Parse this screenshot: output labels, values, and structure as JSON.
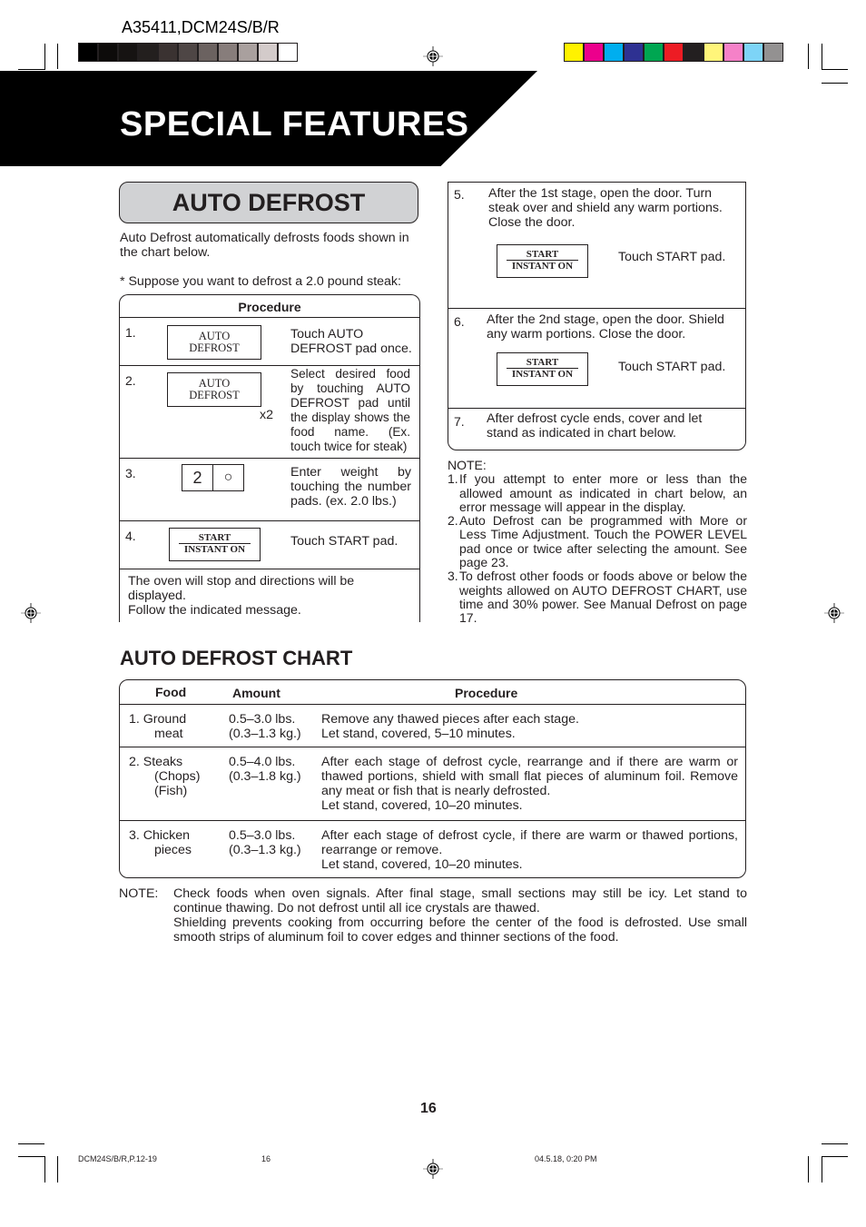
{
  "header": {
    "model": "A35411,DCM24S/B/R",
    "gray_swatches": [
      "#000000",
      "#0d0b0a",
      "#161312",
      "#231f1e",
      "#3a3231",
      "#4e4645",
      "#6b6260",
      "#877d7b",
      "#a9a09e",
      "#d3cbca",
      "#ffffff"
    ],
    "color_swatches": [
      "#fff200",
      "#ec008c",
      "#00aeef",
      "#2e3192",
      "#00a651",
      "#ed1c24",
      "#231f20",
      "#fff57a",
      "#f581c8",
      "#7dd4f7",
      "#939191"
    ]
  },
  "banner": {
    "title": "SPECIAL FEATURES"
  },
  "auto_defrost": {
    "title": "AUTO DEFROST",
    "intro": "Auto Defrost automatically defrosts foods shown in the chart below.",
    "suppose": "*  Suppose you  want to defrost a 2.0 pound steak:",
    "procedure_header": "Procedure",
    "steps": [
      {
        "num": "1.",
        "pad_top": "AUTO",
        "pad_bottom": "DEFROST",
        "text": "Touch AUTO DEFROST pad once."
      },
      {
        "num": "2.",
        "pad_top": "AUTO",
        "pad_bottom": "DEFROST",
        "multiplier": "x2",
        "text": "Select desired food by touching AUTO DEFROST pad until the display shows the food name. (Ex. touch twice for steak)"
      },
      {
        "num": "3.",
        "keys": [
          "2",
          "○"
        ],
        "text": "Enter weight by touching the number pads. (ex. 2.0 lbs.)"
      },
      {
        "num": "4.",
        "pad_top": "START",
        "pad_bottom": "INSTANT ON",
        "text": "Touch START pad."
      }
    ],
    "stop_message": "The oven will stop and directions will be displayed.",
    "follow_message": "Follow the indicated message.",
    "right_steps": [
      {
        "num": "5.",
        "text": "After the 1st stage, open the door. Turn steak over and shield any warm portions. Close the door.",
        "pad_top": "START",
        "pad_bottom": "INSTANT ON",
        "action": "Touch START pad."
      },
      {
        "num": "6.",
        "text": "After the 2nd stage, open the door. Shield any warm portions. Close the door.",
        "pad_top": "START",
        "pad_bottom": "INSTANT ON",
        "action": "Touch START pad."
      },
      {
        "num": "7.",
        "text": "After defrost cycle ends, cover and let stand as indicated in chart below."
      }
    ],
    "note": {
      "label": "NOTE:",
      "items": [
        {
          "n": "1.",
          "text": "If you attempt to enter more or less than the allowed amount as indicated in chart below, an  error message  will appear in the display."
        },
        {
          "n": "2.",
          "text": "Auto Defrost can be programmed with More or Less Time Adjustment. Touch the POWER LEVEL pad once or twice after selecting the amount. See page 23."
        },
        {
          "n": "3.",
          "text": "To defrost other foods or foods above or below the weights allowed on AUTO DEFROST CHART, use time and 30% power. See Manual Defrost on page 17."
        }
      ]
    }
  },
  "chart": {
    "title": "AUTO DEFROST CHART",
    "headers": {
      "food": "Food",
      "amount": "Amount",
      "procedure": "Procedure"
    },
    "rows": [
      {
        "food": [
          "1. Ground",
          "meat"
        ],
        "amount": [
          "0.5–3.0 lbs.",
          "(0.3–1.3 kg.)"
        ],
        "procedure": [
          "Remove any thawed pieces after each stage.",
          "Let stand, covered, 5–10 minutes."
        ]
      },
      {
        "food": [
          "2. Steaks",
          "(Chops)",
          "(Fish)"
        ],
        "amount": [
          "0.5–4.0 lbs.",
          "(0.3–1.8 kg.)"
        ],
        "procedure": [
          "After each stage of defrost cycle, rearrange and if there are warm or thawed portions, shield with small flat pieces of aluminum foil. Remove any meat or fish that is nearly defrosted.",
          "Let stand, covered, 10–20 minutes."
        ]
      },
      {
        "food": [
          "3. Chicken",
          "pieces"
        ],
        "amount": [
          "0.5–3.0 lbs.",
          "(0.3–1.3 kg.)"
        ],
        "procedure": [
          "After each stage of defrost cycle, if there are warm or thawed portions, rearrange or remove.",
          "Let stand, covered, 10–20 minutes."
        ]
      }
    ]
  },
  "bottom_note": {
    "label": "NOTE:",
    "p1": "Check foods when oven signals. After final stage, small sections may still be icy. Let stand to continue thawing. Do not defrost until all ice crystals are thawed.",
    "p2": "Shielding prevents cooking from occurring before the center of the food is defrosted. Use small smooth strips of aluminum foil to cover edges and thinner sections of the food."
  },
  "footer": {
    "page_number": "16",
    "file": "DCM24S/B/R,P.12-19",
    "file_page": "16",
    "timestamp": "04.5.18, 0:20 PM"
  }
}
